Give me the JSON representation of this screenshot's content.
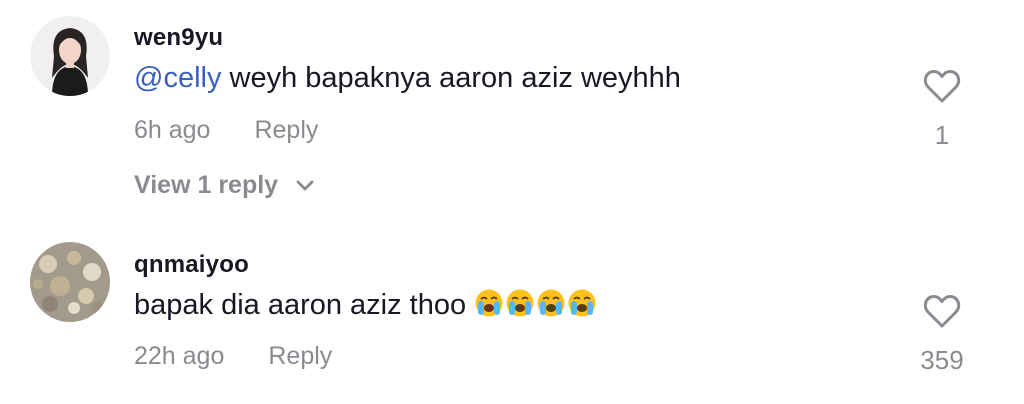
{
  "comments": [
    {
      "username": "wen9yu",
      "mention": "@celly",
      "text": " weyh bapaknya aaron aziz weyhhh",
      "time": "6h ago",
      "reply_label": "Reply",
      "like_count": "1",
      "view_replies": "View 1 reply",
      "icons": {
        "like": "heart-outline-icon",
        "expand": "chevron-down-icon"
      }
    },
    {
      "username": "qnmaiyoo",
      "text": "bapak dia aaron aziz thoo ",
      "emojis": [
        "loudly-crying-face",
        "loudly-crying-face",
        "loudly-crying-face",
        "loudly-crying-face"
      ],
      "time": "22h ago",
      "reply_label": "Reply",
      "like_count": "359",
      "icons": {
        "like": "heart-outline-icon"
      }
    }
  ],
  "colors": {
    "mention": "#3b5fbf",
    "muted": "#8a8b91",
    "text": "#161823"
  }
}
